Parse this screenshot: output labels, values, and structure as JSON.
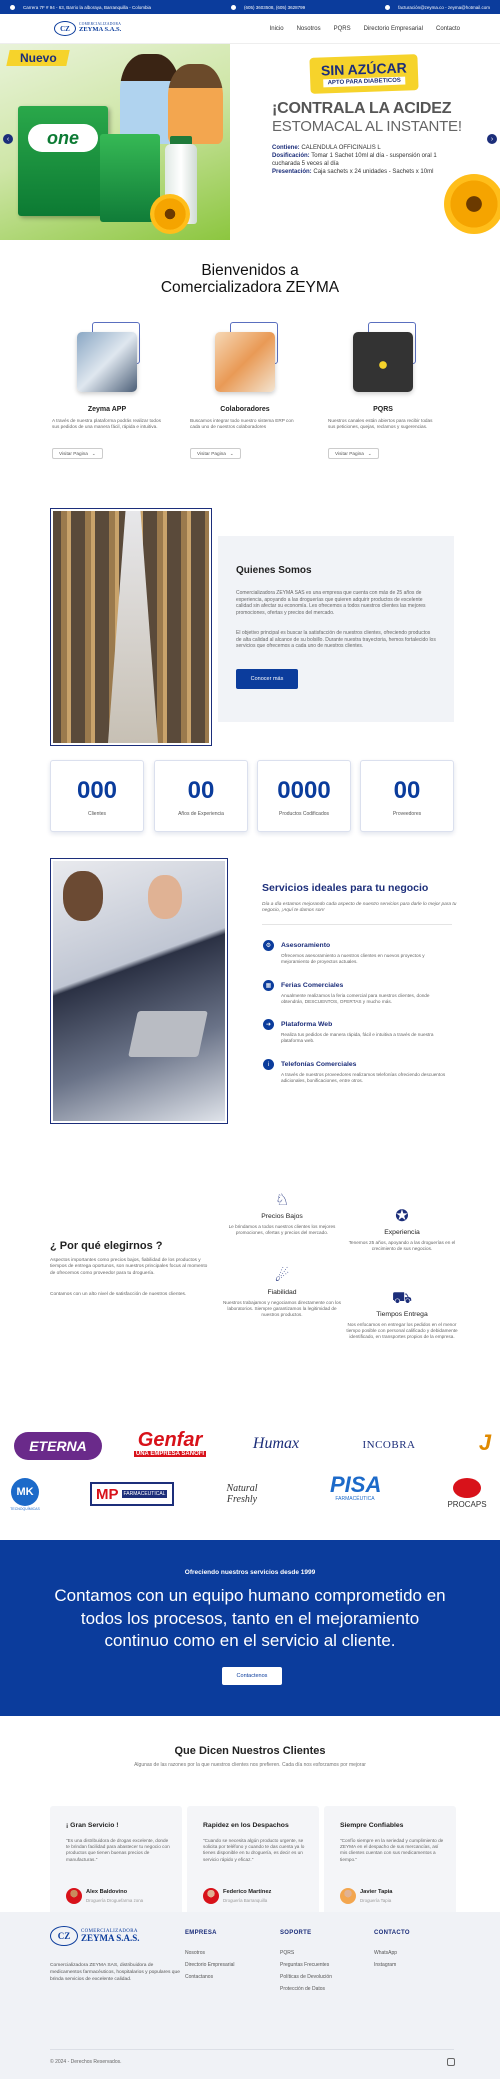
{
  "topbar": {
    "address": "Carrera 7F # 94 - 63, Barrio la alboraya, Barranquilla - Colombia",
    "phone": "(605) 3603508, (605) 3628799",
    "emails": "facturación@zeyma.co - zeyma@hotmail.com"
  },
  "logo": {
    "line1": "COMERCIALIZADORA",
    "line2": "ZEYMA S.A.S.",
    "mark": "CZ"
  },
  "nav": {
    "items": [
      "Inicio",
      "Nosotros",
      "PQRS",
      "Directorio Empresarial",
      "Contacto"
    ]
  },
  "hero": {
    "ribbon": "Nuevo",
    "product_logo": "one",
    "badge_title": "SIN AZÚCAR",
    "badge_sub": "APTO PARA DIABETICOS",
    "headline_1": "¡CONTRALA LA ACIDEZ",
    "headline_2": "ESTOMACAL AL INSTANTE!",
    "contiene_label": "Contiene:",
    "contiene": "CALENDULA OFFICINALIS L",
    "dosificacion_label": "Dosificación:",
    "dosificacion": "Tomar 1 Sachet 10ml al día - suspensión oral 1 cucharada 5 veces al día",
    "presentacion_label": "Presentación:",
    "presentacion": "Caja sachets x 24 unidades - Sachets x 10ml",
    "prev": "‹",
    "next": "›"
  },
  "welcome": {
    "title_1": "Bienvenidos a",
    "title_2": "Comercializadora ZEYMA"
  },
  "cards": [
    {
      "title": "Zeyma APP",
      "desc": "A través de nuestra plataforma podrás realizar todos sus pedidos de una manera fácil, rápida e intuitiva.",
      "button": "Visitar Pagina"
    },
    {
      "title": "Colaboradores",
      "desc": "Buscamos integrar todo nuestro sistema ERP con cada uno de nuestros colaboradores",
      "button": "Visitar Pagina"
    },
    {
      "title": "PQRS",
      "desc": "Nuestros canales están abiertos para recibir todas sus peticiones, quejas, reclamos y sugerencias.",
      "button": "Visitar Pagina"
    }
  ],
  "about": {
    "title": "Quienes Somos",
    "p1": "Comercializadora ZEYMA SAS es una empresa que cuenta con más de 25 años de experiencia, apoyando a las droguerías que quieren adquirir productos de excelente calidad sin afectar su economía. Les ofrecemos a todos nuestros clientes las mejores promociones, ofertas y precios del mercado.",
    "p2": "El objetivo principal es buscar la satisfacción de nuestros clientes, ofreciendo productos de alta calidad al alcance de su bolsillo. Durante nuestra trayectoria, hemos fortalecido los servicios que ofrecemos a cada uno de nuestros clientes.",
    "button": "Conocer más"
  },
  "stats": [
    {
      "value": "000",
      "label": "Clientes"
    },
    {
      "value": "00",
      "label": "Años de Experiencia"
    },
    {
      "value": "0000",
      "label": "Productos Codificados"
    },
    {
      "value": "00",
      "label": "Proveedores"
    }
  ],
  "services": {
    "title": "Servicios ideales para tu negocio",
    "subtitle": "Día a día estamos mejorando cada aspecto de nuestro servicios para darle lo mejor para tu negocio, ¡Aquí te damos son!",
    "items": [
      {
        "title": "Asesoramiento",
        "desc": "Ofrecemos asesoramiento a nuestros clientes en nuevos proyectos y mejoramiento de proyectos actuales.",
        "icon": "gear-icon"
      },
      {
        "title": "Ferias Comerciales",
        "desc": "Anualmente realizamos la feria comercial para nuestros clientes, donde obtendrán, DESCUENTOS, OFERTAS y mucho más.",
        "icon": "calendar-icon"
      },
      {
        "title": "Plataforma Web",
        "desc": "Realiza tus pedidos de manera rápida, fácil e intuitiva a través de nuestra plataforma web.",
        "icon": "arrow-icon"
      },
      {
        "title": "Telefonías Comerciales",
        "desc": "A través de nuestros proveedores realizamos telefonías ofreciendo descuentos adicionales, bonificaciones, entre otros.",
        "icon": "info-icon"
      }
    ]
  },
  "why": {
    "title": "¿ Por qué elegirnos ?",
    "p1": "Aspectos importantes como precios bajos, fiabilidad de los productos y tiempos de entrega oportunos, son nuestros principales focus al momento de ofrecemos como proveedor para tu droguería.",
    "p2": "Contamos con un alto nivel de satisfacción de nuestros clientes.",
    "features": [
      {
        "title": "Precios Bajos",
        "desc": "Le brindamos a todos nuestros clientes los mejores promociones, ofertas y precios del mercado."
      },
      {
        "title": "Experiencia",
        "desc": "Tenemos 25 años, apoyando a las droguerías en el crecimiento de sus negocios."
      },
      {
        "title": "Fiabilidad",
        "desc": "Nuestros trabajamos y negociamos directamente con los laboratorios. Siempre garantizamos la legitimidad de nuestros productos."
      },
      {
        "title": "Tiempos Entrega",
        "desc": "Nos enfocamos en entregar los pedidos en el menor tiempo posible con personal calificado y debidamente identificado, en transportes propios de la empresa."
      }
    ]
  },
  "brands": {
    "row1": [
      "ETERNA",
      "Genfar",
      "UNA EMPRESA SANOFI",
      "Humax",
      "INCOBRA",
      "J"
    ],
    "row2": [
      "MK",
      "TECNOQUÍMICAS",
      "MP",
      "FARMACEUTICAL",
      "Natural Freshly",
      "PISA",
      "FARMACÉUTICA",
      "PROCAPS"
    ]
  },
  "band": {
    "kicker": "Ofreciendo nuestros servicios desde 1999",
    "text": "Contamos con un equipo humano comprometido en todos los procesos, tanto en el mejoramiento continuo como en el servicio al cliente.",
    "button": "Contactenos"
  },
  "testimonials": {
    "title": "Que Dicen Nuestros Clientes",
    "subtitle": "Algunas de las razones por la que nuestros clientes nos prefieren. Cada día nos esforzamos por mejorar",
    "items": [
      {
        "heading": "¡ Gran Servicio !",
        "quote": "\"Es una distribuidora de drogas excelente, donde te brindan facilidad para abastecer tu negocio con productos que tienen buenas precios de manufacturas.\"",
        "name": "Alex Baldovino",
        "role": "Droguería Droguefarma zona"
      },
      {
        "heading": "Rapidez en los Despachos",
        "quote": "\"Cuando se necesita algún producto urgente, se solicita por teléfono y cuando te das cuenta ya lo tienes disponible en tu droguería, es decir es un servicio rápido y eficaz.\"",
        "name": "Federico Martínez",
        "role": "Droguería Barranquilla"
      },
      {
        "heading": "Siempre Confiables",
        "quote": "\"Confío siempre en la seriedad y cumplimiento de ZEYMA en el despacho de sus mercancías, así mis clientes cuentan con sus medicamentos a tiempo.\"",
        "name": "Javier Tapia",
        "role": "Droguería Tapia"
      }
    ]
  },
  "footer": {
    "desc": "Comercializadora ZEYMA SAS, distribuidora de medicamentos farmacéuticos, hospitalarios y populares que brinda servicios de excelente calidad.",
    "cols": [
      {
        "title": "EMPRESA",
        "links": [
          "Nosotros",
          "Directorio Empresarial",
          "Contactanos"
        ]
      },
      {
        "title": "SOPORTE",
        "links": [
          "PQRS",
          "Preguntas Frecuentes",
          "Políticas de Devolución",
          "Protección de Datos"
        ]
      },
      {
        "title": "CONTACTO",
        "links": [
          "WhatsApp",
          "Instagram"
        ]
      }
    ],
    "copyright": "© 2024 - Derechos Reservados."
  },
  "colors": {
    "brand": "#0b3c9c",
    "accent": "#f6d32b"
  }
}
